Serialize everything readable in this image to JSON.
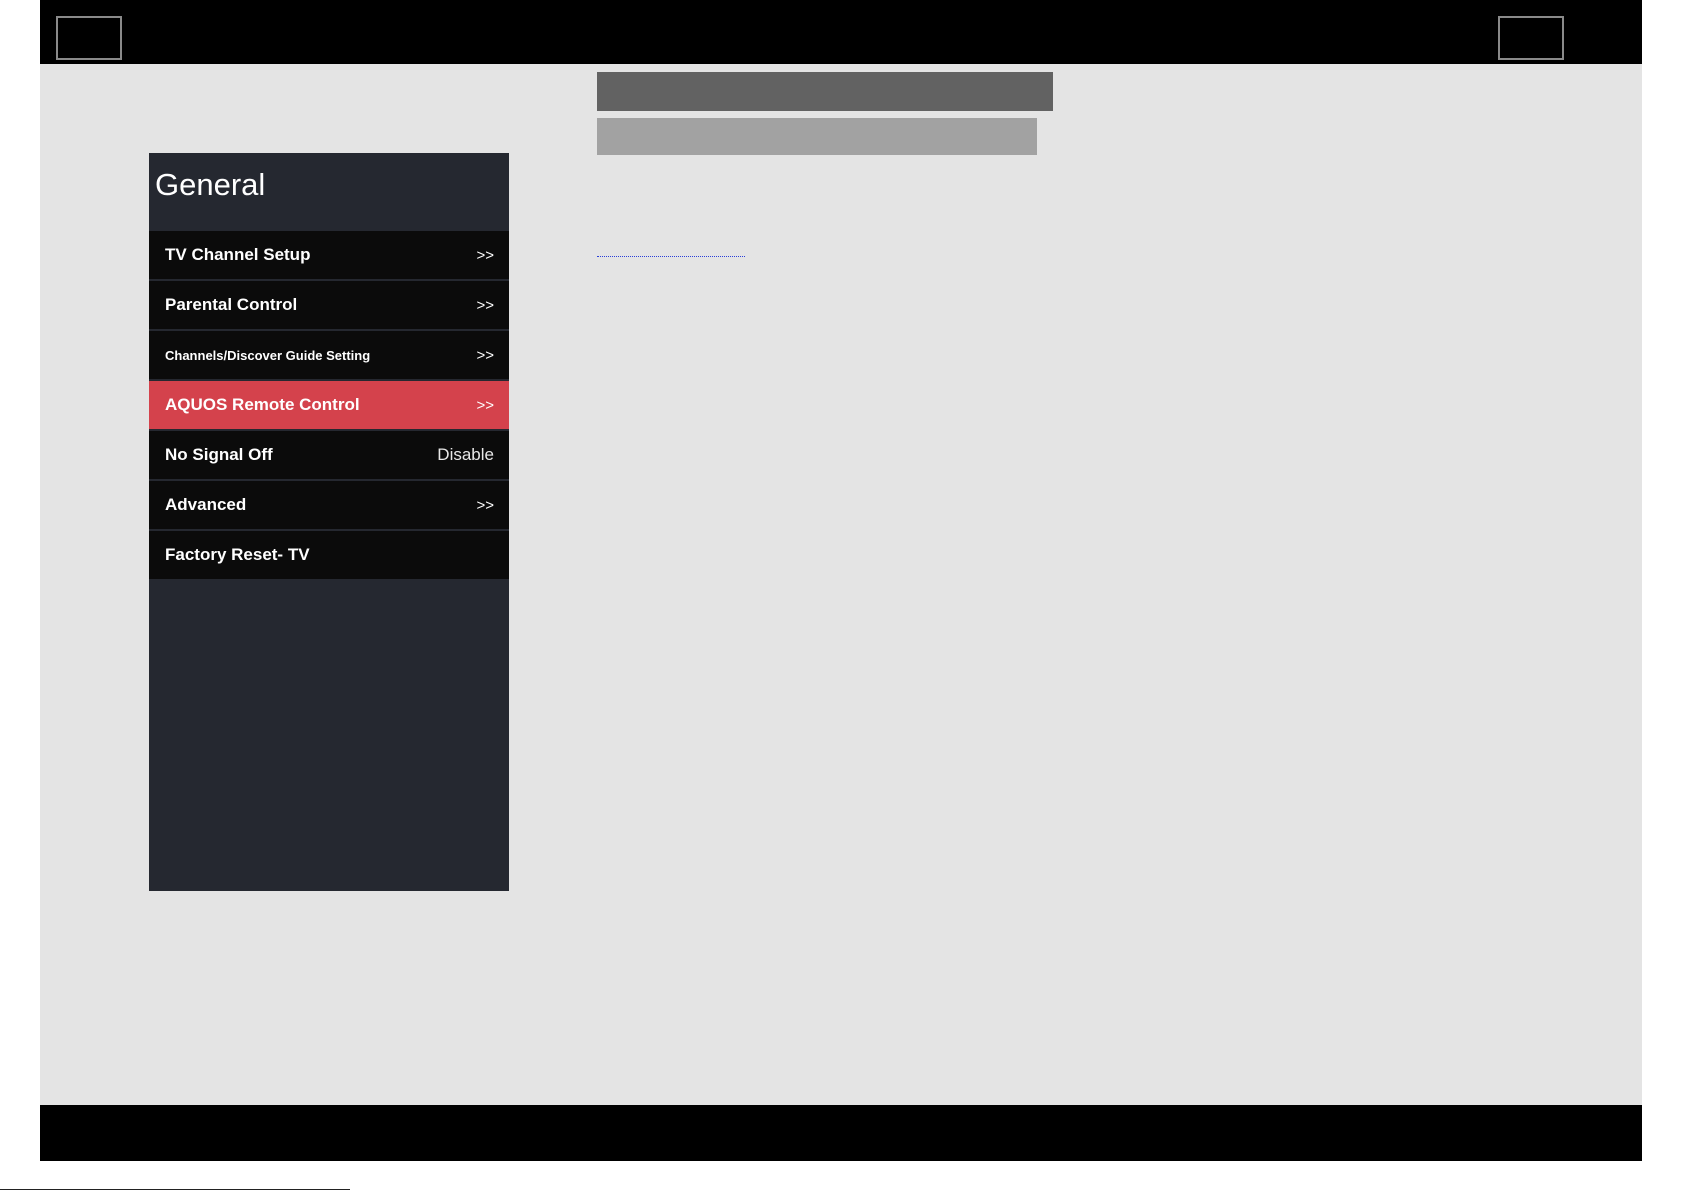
{
  "menu": {
    "title": "General",
    "items": [
      {
        "label": "TV Channel Setup",
        "value": ">>",
        "value_type": "arrow",
        "selected": false
      },
      {
        "label": "Parental Control",
        "value": ">>",
        "value_type": "arrow",
        "selected": false
      },
      {
        "label": "Channels/Discover Guide Setting",
        "value": ">>",
        "value_type": "arrow",
        "selected": false
      },
      {
        "label": "AQUOS Remote Control",
        "value": ">>",
        "value_type": "arrow",
        "selected": true
      },
      {
        "label": "No Signal Off",
        "value": "Disable",
        "value_type": "text",
        "selected": false
      },
      {
        "label": "Advanced",
        "value": ">>",
        "value_type": "arrow",
        "selected": false
      },
      {
        "label": "Factory Reset- TV",
        "value": "",
        "value_type": "none",
        "selected": false
      }
    ]
  },
  "colors": {
    "selected_accent": "#d4424c",
    "panel_bg": "#252830",
    "item_bg": "#0b0b0b",
    "page_bg": "#e4e4e4",
    "bars": "#000000"
  }
}
